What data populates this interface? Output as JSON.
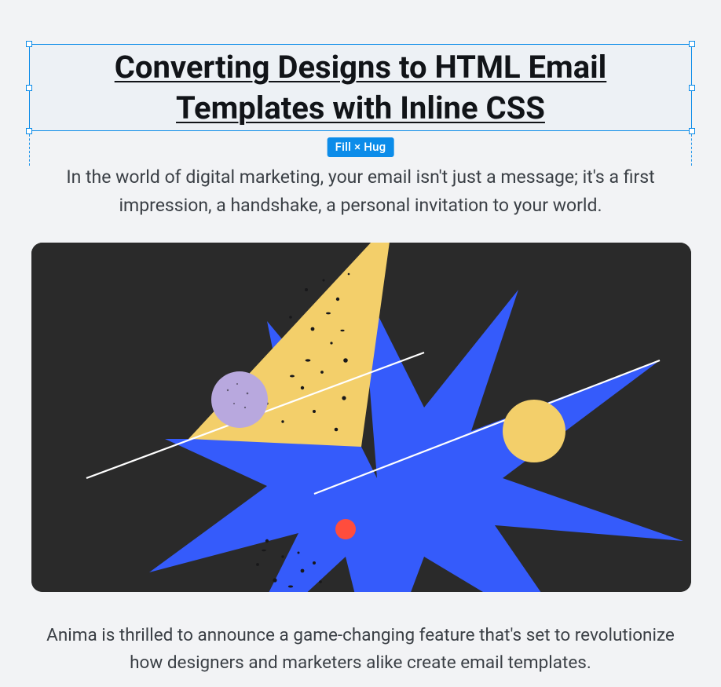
{
  "selection": {
    "badge_label": "Fill × Hug"
  },
  "content": {
    "heading": "Converting Designs to HTML Email Templates with Inline CSS",
    "subheading": "In the world of digital marketing, your email isn't just a message; it's a first impression, a handshake, a personal invitation to your world.",
    "body": "Anima is thrilled to announce a game-changing feature that's set to revolutionize how designers and marketers alike create email templates."
  },
  "hero": {
    "bg": "#2a2a2a",
    "starburst_color": "#355bfb",
    "triangle_color": "#f3cf6a",
    "circle_small_color": "#b8a8de",
    "circle_big_color": "#f3cf6a",
    "dot_color": "#ff4d3d",
    "line_color": "#ffffff",
    "speckle_color": "#18181a"
  }
}
